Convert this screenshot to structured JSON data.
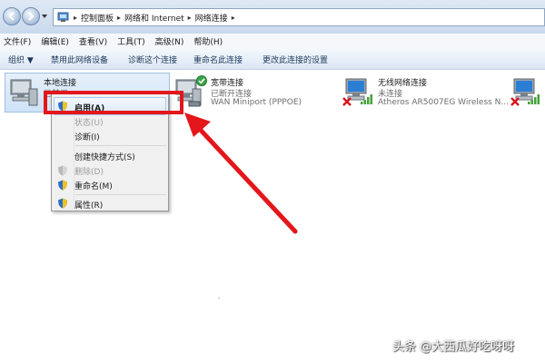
{
  "address": {
    "breadcrumbs": [
      "控制面板",
      "网络和 Internet",
      "网络连接"
    ]
  },
  "menu": [
    "文件(F)",
    "编辑(E)",
    "查看(V)",
    "工具(T)",
    "高级(N)",
    "帮助(H)"
  ],
  "toolbar": {
    "organize": "组织 ▼",
    "items": [
      "禁用此网络设备",
      "诊断这个连接",
      "重命名此连接",
      "更改此连接的设置"
    ]
  },
  "connections": [
    {
      "name": "本地连接",
      "status": "已禁用"
    },
    {
      "name": "宽带连接",
      "status": "已断开连接",
      "device": "WAN Miniport (PPPOE)"
    },
    {
      "name": "无线网络连接",
      "status": "未连接",
      "device": "Atheros AR5007EG Wireless N..."
    }
  ],
  "context_menu": {
    "items": [
      {
        "label": "启用(A)",
        "bold": true,
        "disabled": false
      },
      {
        "label": "状态(U)",
        "disabled": true
      },
      {
        "label": "诊断(I)",
        "disabled": false
      },
      {
        "label": "创建快捷方式(S)",
        "disabled": false
      },
      {
        "label": "删除(D)",
        "disabled": true
      },
      {
        "label": "重命名(M)",
        "disabled": false
      },
      {
        "label": "属性(R)",
        "disabled": false
      }
    ]
  },
  "watermark": "头条 @大西瓜好吃呀呀",
  "colors": {
    "highlight": "#e3171b",
    "link": "#1e395b"
  }
}
